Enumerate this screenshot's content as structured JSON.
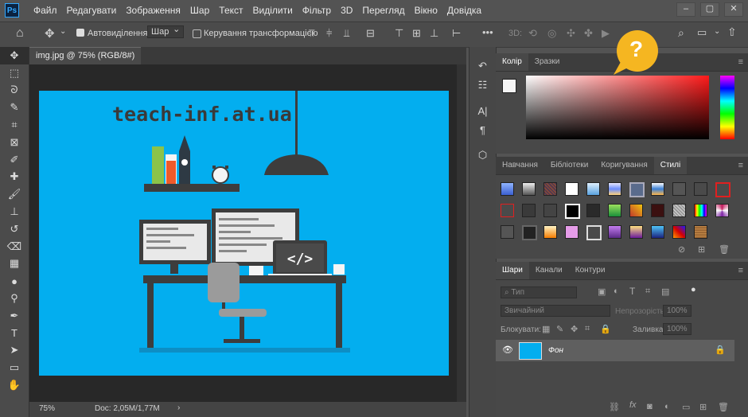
{
  "app": {
    "logo": "Ps"
  },
  "menu": [
    "Файл",
    "Редагувати",
    "Зображення",
    "Шар",
    "Текст",
    "Виділити",
    "Фільтр",
    "3D",
    "Перегляд",
    "Вікно",
    "Довідка"
  ],
  "options": {
    "auto_select_label": "Автовиділення:",
    "auto_select_value": "Шар",
    "transform_label": "Керування трансформацією",
    "three_d_label": "3D:"
  },
  "document": {
    "tab_title": "img.jpg @ 75% (RGB/8#)",
    "close": "×",
    "zoom": "75%",
    "doc_info": "Doc: 2,05M/1,77M",
    "image_text": "teach-inf.at.ua",
    "code_glyph": "</>"
  },
  "panels": {
    "color_tabs": [
      "Колір",
      "Зразки"
    ],
    "styles_tabs": [
      "Навчання",
      "Бібліотеки",
      "Коригування",
      "Стилі"
    ],
    "layers_tabs": [
      "Шари",
      "Канали",
      "Контури"
    ],
    "help_bubble": "?",
    "layers": {
      "filter_placeholder": "Тип",
      "blend_mode": "Звичайний",
      "opacity_label": "Непрозорість:",
      "opacity_value": "100%",
      "lock_label": "Блокувати:",
      "fill_label": "Заливка:",
      "fill_value": "100%",
      "layer_name": "Фон"
    }
  },
  "colors": {
    "accent": "#03aeef",
    "bubble": "#f5b621",
    "desk": "#3d3d3d"
  }
}
